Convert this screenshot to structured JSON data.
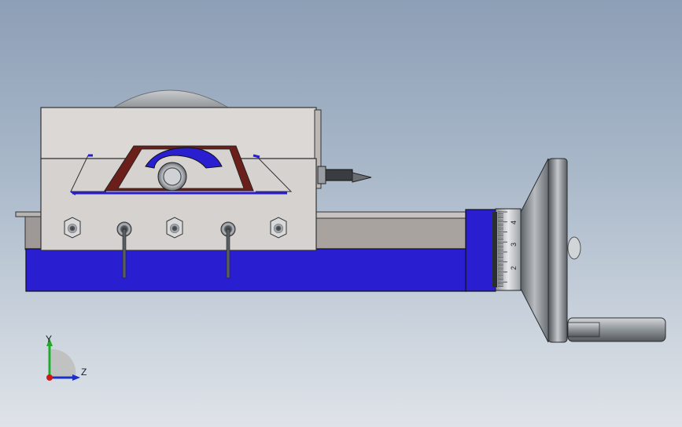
{
  "viewport": {
    "background_top": "#8d9fb6",
    "background_bottom": "#dfe3e8"
  },
  "model": {
    "name": "machine-vise-with-handwheel",
    "colors": {
      "base_blue": "#2a1fd0",
      "body_gray": "#d9d5d3",
      "cutout_brown": "#6b1f1a",
      "rail_gray": "#a9a3a0",
      "steel": "#9ea4aa"
    }
  },
  "dial": {
    "scale_labels": [
      "4",
      "3",
      "2"
    ]
  },
  "triad": {
    "y_label": "Y",
    "z_label": "Z",
    "colors": {
      "y": "#1faa2a",
      "z": "#1a2ec8",
      "origin": "#d01818"
    }
  }
}
